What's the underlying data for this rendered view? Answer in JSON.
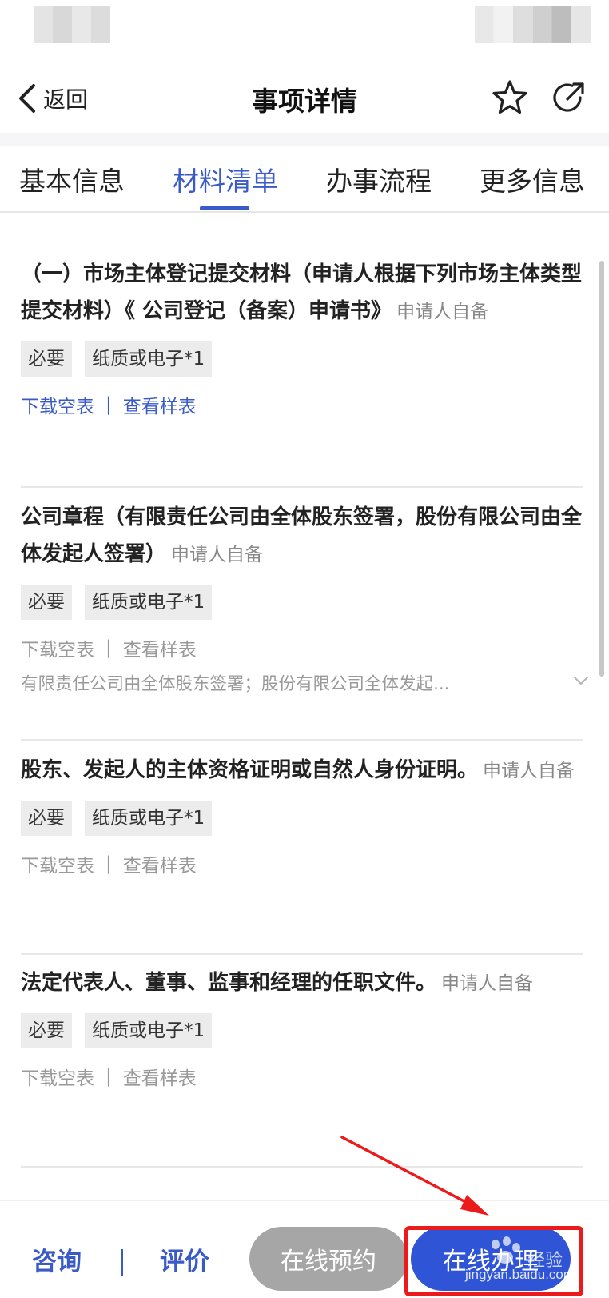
{
  "navbar": {
    "back_label": "返回",
    "title": "事项详情",
    "icons": [
      "chevron-left-icon",
      "star-icon",
      "share-icon"
    ]
  },
  "tabs": [
    {
      "label": "基本信息",
      "active": false
    },
    {
      "label": "材料清单",
      "active": true
    },
    {
      "label": "办事流程",
      "active": false
    },
    {
      "label": "更多信息",
      "active": false
    }
  ],
  "materials": [
    {
      "title": "（一）市场主体登记提交材料（申请人根据下列市场主体类型提交材料）《 公司登记（备案）申请书》",
      "source": "申请人自备",
      "tags": [
        "必要",
        "纸质或电子*1"
      ],
      "download": "下载空表",
      "sep": "|",
      "sample": "查看样表"
    },
    {
      "title": "公司章程（有限责任公司由全体股东签署，股份有限公司由全体发起人签署）",
      "source": "申请人自备",
      "tags": [
        "必要",
        "纸质或电子*1"
      ],
      "download": "下载空表",
      "sep": "|",
      "sample": "查看样表",
      "note": "有限责任公司由全体股东签署；股份有限公司全体发起..."
    },
    {
      "title": "股东、发起人的主体资格证明或自然人身份证明。",
      "source": "申请人自备",
      "tags": [
        "必要",
        "纸质或电子*1"
      ],
      "download": "下载空表",
      "sep": "|",
      "sample": "查看样表"
    },
    {
      "title": "法定代表人、董事、监事和经理的任职文件。",
      "source": "申请人自备",
      "tags": [
        "必要",
        "纸质或电子*1"
      ],
      "download": "下载空表",
      "sep": "|",
      "sample": "查看样表"
    }
  ],
  "bottom_bar": {
    "consult": "咨询",
    "divider": "|",
    "evaluate": "评价",
    "reserve": "在线预约",
    "online": "在线办理"
  },
  "watermark": {
    "url": "jingyan.baidu.com",
    "brand": "经验"
  },
  "colors": {
    "accent": "#3a5bc7",
    "primary_button": "#2f54d6",
    "disabled_button": "#a6a6a6",
    "annotation": "#ec1b1b"
  }
}
